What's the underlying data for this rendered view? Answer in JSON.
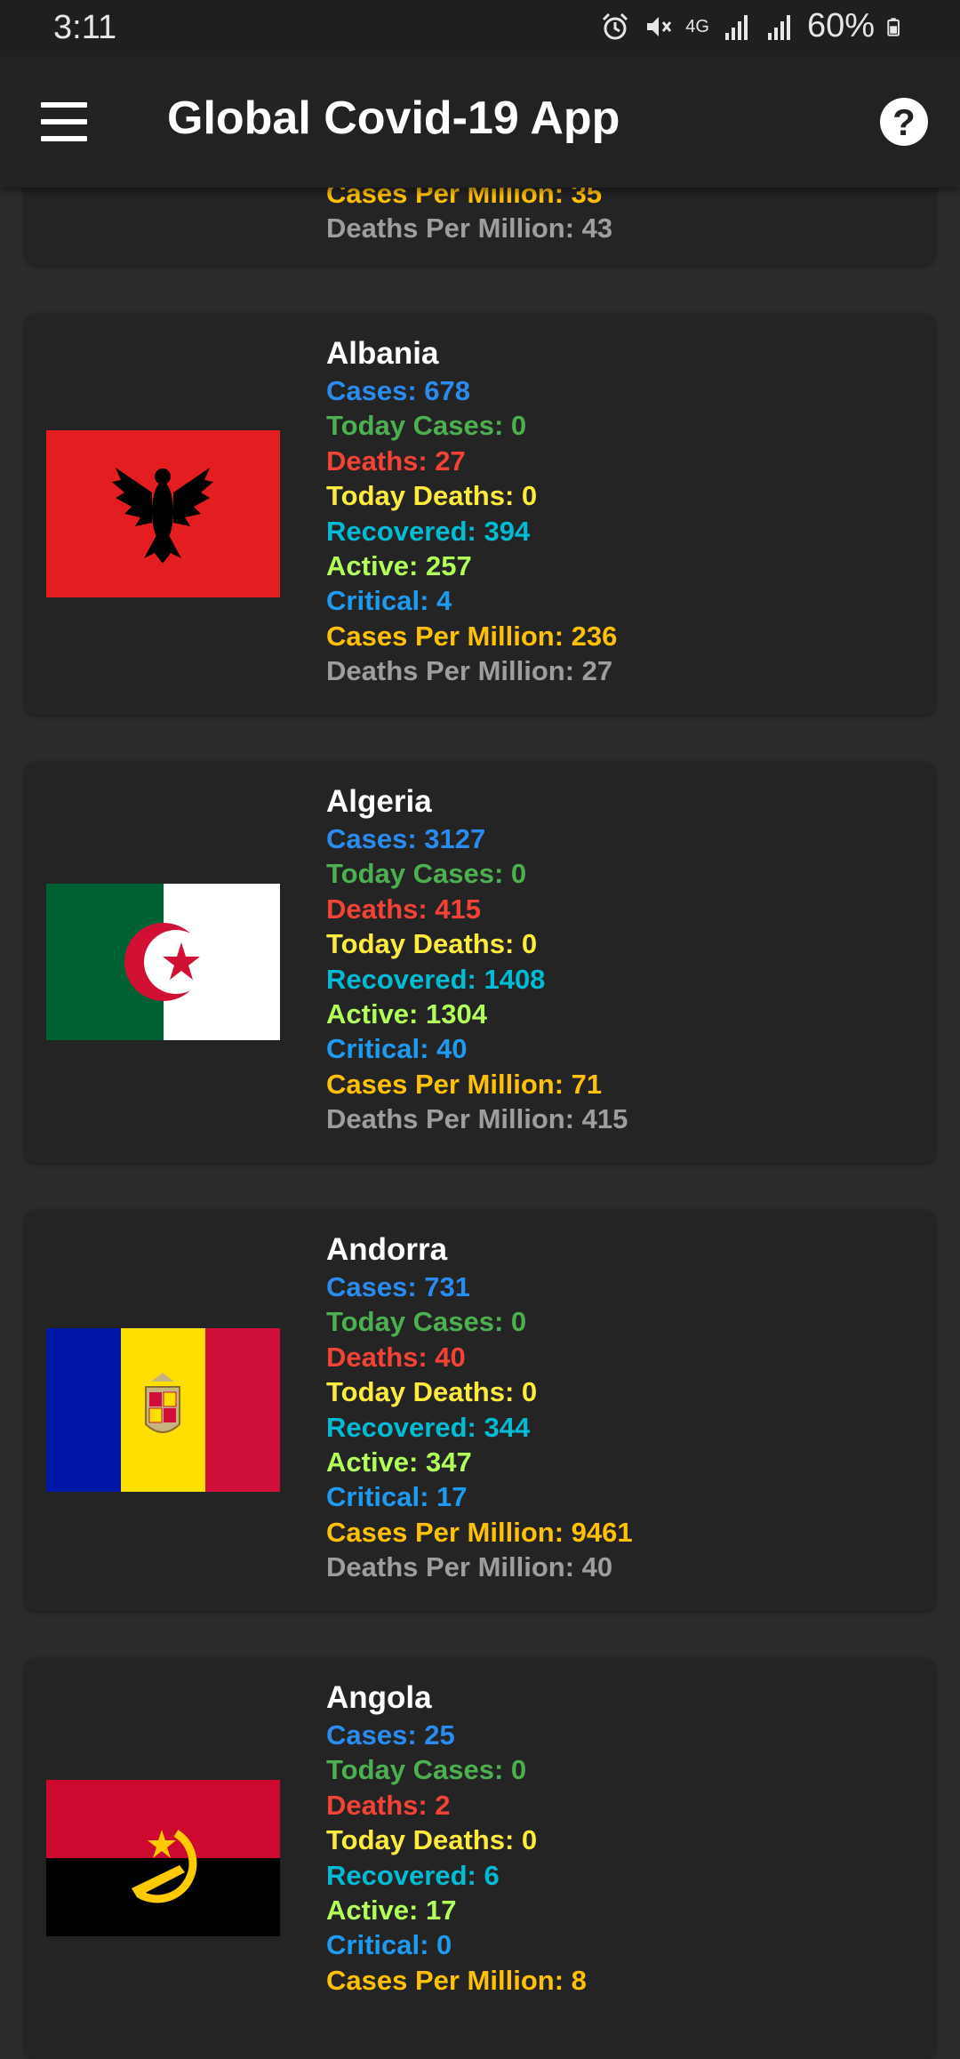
{
  "status_bar": {
    "time": "3:11",
    "network": "4G",
    "battery": "60%"
  },
  "app_bar": {
    "title": "Global Covid-19 App",
    "menu_icon": "hamburger-menu-icon",
    "help_icon": "help-circle-icon"
  },
  "colors": {
    "cases": "#2a8cf0",
    "today_cases": "#4caf50",
    "deaths": "#f44336",
    "today_deaths": "#ffeb3b",
    "recovered": "#00bcd4",
    "active": "#b2ff59",
    "critical": "#1e9bf0",
    "cases_per_million": "#ffc107",
    "deaths_per_million": "#9e9e9e"
  },
  "countries": [
    {
      "name": "",
      "cases_per_million": "Cases Per Million: 35",
      "deaths_per_million": "Deaths Per Million: 43"
    },
    {
      "name": "Albania",
      "flag": "albania-flag",
      "cases": "Cases: 678",
      "today_cases": "Today Cases: 0",
      "deaths": "Deaths: 27",
      "today_deaths": "Today Deaths: 0",
      "recovered": "Recovered: 394",
      "active": "Active: 257",
      "critical": "Critical: 4",
      "cases_per_million": "Cases Per Million: 236",
      "deaths_per_million": "Deaths Per Million: 27"
    },
    {
      "name": "Algeria",
      "flag": "algeria-flag",
      "cases": "Cases: 3127",
      "today_cases": "Today Cases: 0",
      "deaths": "Deaths: 415",
      "today_deaths": "Today Deaths: 0",
      "recovered": "Recovered: 1408",
      "active": "Active: 1304",
      "critical": "Critical: 40",
      "cases_per_million": "Cases Per Million: 71",
      "deaths_per_million": "Deaths Per Million: 415"
    },
    {
      "name": "Andorra",
      "flag": "andorra-flag",
      "cases": "Cases: 731",
      "today_cases": "Today Cases: 0",
      "deaths": "Deaths: 40",
      "today_deaths": "Today Deaths: 0",
      "recovered": "Recovered: 344",
      "active": "Active: 347",
      "critical": "Critical: 17",
      "cases_per_million": "Cases Per Million: 9461",
      "deaths_per_million": "Deaths Per Million: 40"
    },
    {
      "name": "Angola",
      "flag": "angola-flag",
      "cases": "Cases: 25",
      "today_cases": "Today Cases: 0",
      "deaths": "Deaths: 2",
      "today_deaths": "Today Deaths: 0",
      "recovered": "Recovered: 6",
      "active": "Active: 17",
      "critical": "Critical: 0",
      "cases_per_million": "Cases Per Million: 8"
    }
  ]
}
